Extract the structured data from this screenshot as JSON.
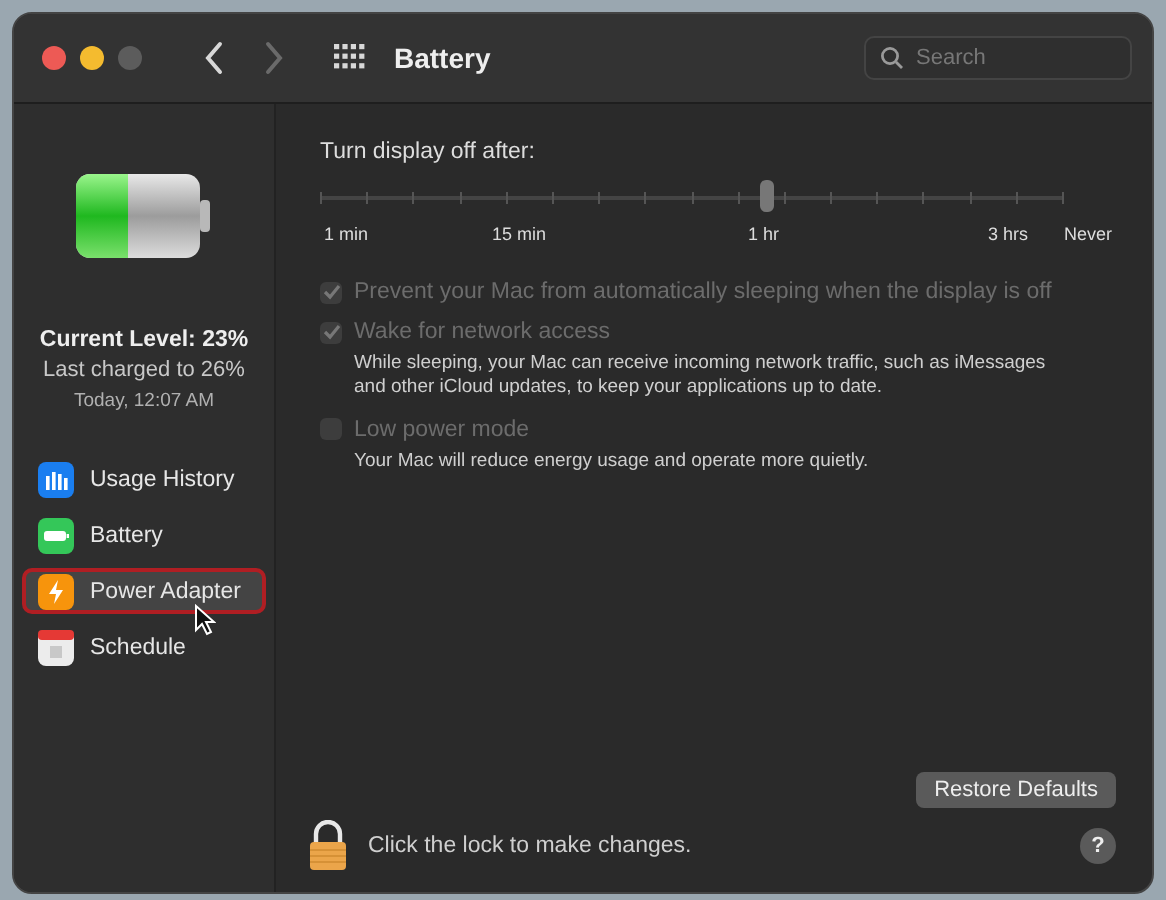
{
  "window": {
    "title": "Battery"
  },
  "search": {
    "placeholder": "Search"
  },
  "sidebar": {
    "current_level": "Current Level: 23%",
    "last_charged": "Last charged to 26%",
    "charged_time": "Today, 12:07 AM",
    "items": [
      {
        "label": "Usage History",
        "selected": false,
        "highlighted": false
      },
      {
        "label": "Battery",
        "selected": false,
        "highlighted": false
      },
      {
        "label": "Power Adapter",
        "selected": true,
        "highlighted": true
      },
      {
        "label": "Schedule",
        "selected": false,
        "highlighted": false
      }
    ]
  },
  "display_slider": {
    "label": "Turn display off after:",
    "level": 0.6,
    "ticks": [
      "1 min",
      "15 min",
      "1 hr",
      "3 hrs",
      "Never"
    ]
  },
  "options": [
    {
      "label": "Prevent your Mac from automatically sleeping when the display is off",
      "checked": true,
      "disabled": true
    },
    {
      "label": "Wake for network access",
      "checked": true,
      "disabled": true,
      "description": "While sleeping, your Mac can receive incoming network traffic, such as iMessages and other iCloud updates, to keep your applications up to date."
    },
    {
      "label": "Low power mode",
      "checked": false,
      "disabled": true,
      "description": "Your Mac will reduce energy usage and operate more quietly."
    }
  ],
  "restore_button": "Restore Defaults",
  "lock_text": "Click the lock to make changes.",
  "help_button": "?"
}
